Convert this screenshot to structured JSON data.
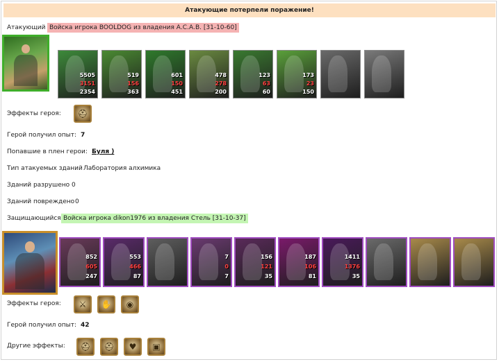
{
  "header": {
    "title": "Атакующие потерпели поражение!"
  },
  "attacker": {
    "label": "Атакующий",
    "tag": "Войска игрока BOOLDOG из владения А.С.А.В. [31-10-60]",
    "hero_icon": "elf-hero-portrait",
    "units": [
      {
        "name": "unit-druid",
        "icon": "druid-unit-icon",
        "n1": "5505",
        "n2": "3151",
        "n3": "2354",
        "color": "#3d8a3a"
      },
      {
        "name": "unit-elf-swordsman",
        "icon": "elf-swordsman-unit-icon",
        "n1": "519",
        "n2": "156",
        "n3": "363",
        "color": "#4a8a32"
      },
      {
        "name": "unit-elf-guard",
        "icon": "elf-guard-unit-icon",
        "n1": "601",
        "n2": "150",
        "n3": "451",
        "color": "#2f7a2c"
      },
      {
        "name": "unit-griffin",
        "icon": "griffin-unit-icon",
        "n1": "478",
        "n2": "278",
        "n3": "200",
        "color": "#6a8a40"
      },
      {
        "name": "unit-elf-archer",
        "icon": "elf-archer-unit-icon",
        "n1": "123",
        "n2": "63",
        "n3": "60",
        "color": "#3a7a30"
      },
      {
        "name": "unit-dryad",
        "icon": "dryad-unit-icon",
        "n1": "173",
        "n2": "23",
        "n3": "150",
        "color": "#5aa03a"
      },
      {
        "name": "unit-grey-mage",
        "icon": "dead-mage-unit-icon",
        "color": "#6a6a6a"
      },
      {
        "name": "unit-grey-treant",
        "icon": "dead-treant-unit-icon",
        "color": "#7a7a7a"
      }
    ],
    "effects_label": "Эффекты героя:",
    "effects": [
      {
        "name": "effect-helm",
        "icon": "helm-effect-icon",
        "glyph": "⛑"
      }
    ],
    "exp_label": "Герой получил опыт:",
    "exp_value": "7",
    "captured_label": "Попавшие в плен герои:",
    "captured_value": "Буля )",
    "building_type_label": "Тип атакуемых зданий",
    "building_type_value": "Лаборатория алхимика",
    "destroyed_label": "Зданий разрушено",
    "destroyed_value": "0",
    "damaged_label": "Зданий повреждено",
    "damaged_value": "0"
  },
  "defender": {
    "label": "Защищающийся",
    "tag": "Войска игрока dikon1976 из владения Стель [31-10-37]",
    "hero_icon": "dark-hero-portrait",
    "units": [
      {
        "name": "unit-beast",
        "icon": "beast-unit-icon",
        "n1": "852",
        "n2": "605",
        "n3": "247",
        "color": "#6a3a5a"
      },
      {
        "name": "unit-assassin",
        "icon": "assassin-unit-icon",
        "n1": "553",
        "n2": "466",
        "n3": "87",
        "color": "#5a2a6a"
      },
      {
        "name": "unit-grey-knight",
        "icon": "dead-knight-unit-icon",
        "color": "#5e5e5e"
      },
      {
        "name": "unit-harpy",
        "icon": "harpy-unit-icon",
        "n1": "7",
        "n2": "0",
        "n3": "7",
        "color": "#6a3a70"
      },
      {
        "name": "unit-crossbowman",
        "icon": "crossbowman-unit-icon",
        "n1": "156",
        "n2": "121",
        "n3": "35",
        "color": "#5a2a5a"
      },
      {
        "name": "unit-warlock",
        "icon": "warlock-unit-icon",
        "n1": "187",
        "n2": "106",
        "n3": "81",
        "color": "#7a1a6a"
      },
      {
        "name": "unit-sorceress",
        "icon": "sorceress-unit-icon",
        "n1": "1411",
        "n2": "1376",
        "n3": "35",
        "color": "#4a1a5a"
      },
      {
        "name": "unit-grey-spider",
        "icon": "dead-spider-unit-icon",
        "color": "#6a6a6a"
      },
      {
        "name": "unit-egg-1",
        "icon": "egg-unit-icon",
        "color": "#a88a4a"
      },
      {
        "name": "unit-egg-2",
        "icon": "egg-unit-icon",
        "color": "#a88a4a"
      }
    ],
    "effects_label": "Эффекты героя:",
    "effects": [
      {
        "name": "effect-sword",
        "icon": "sword-effect-icon",
        "glyph": "⚔"
      },
      {
        "name": "effect-hand",
        "icon": "hand-effect-icon",
        "glyph": "✋"
      },
      {
        "name": "effect-shield",
        "icon": "shield-effect-icon",
        "glyph": "◉"
      }
    ],
    "exp_label": "Герой получил опыт:",
    "exp_value": "42",
    "other_label": "Другие эффекты:",
    "other_effects": [
      {
        "name": "other-effect-helm-1",
        "icon": "helm-effect-icon",
        "glyph": "⛑"
      },
      {
        "name": "other-effect-helm-2",
        "icon": "helm-effect-icon",
        "glyph": "⛑"
      },
      {
        "name": "other-effect-heart",
        "icon": "heart-effect-icon",
        "glyph": "♥"
      },
      {
        "name": "other-effect-armor",
        "icon": "armor-effect-icon",
        "glyph": "▣"
      }
    ]
  }
}
